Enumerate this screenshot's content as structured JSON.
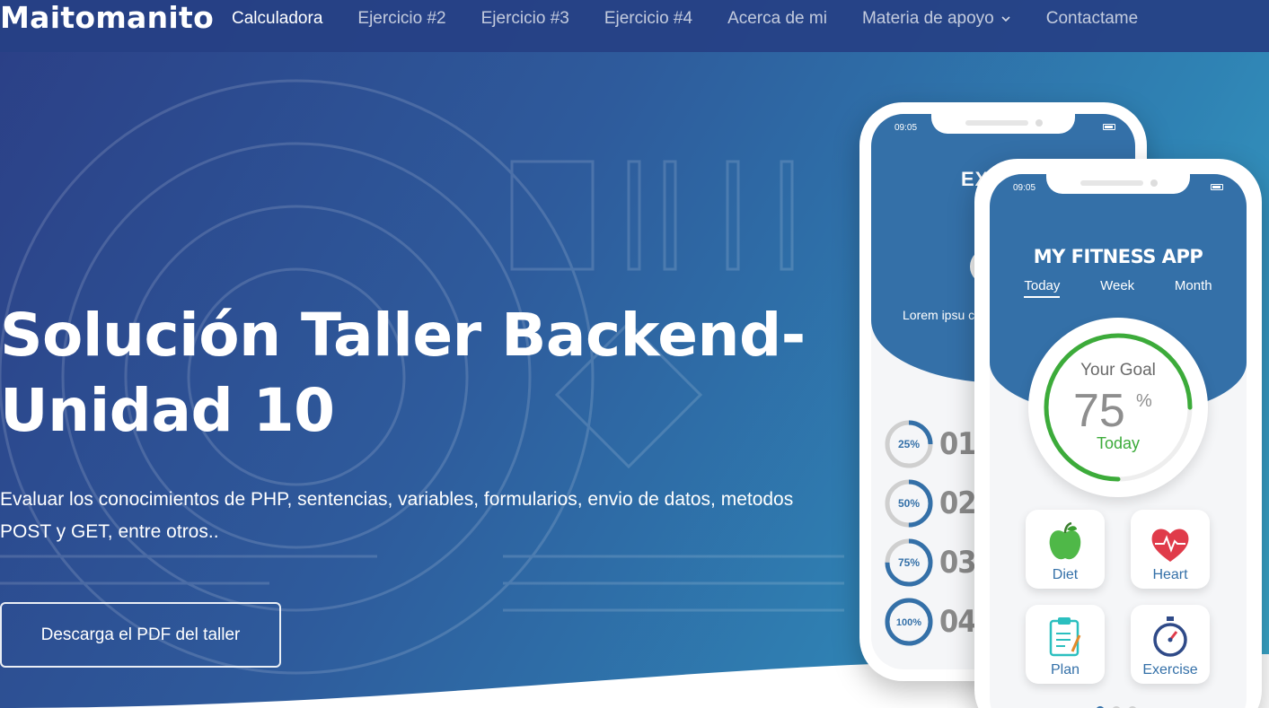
{
  "brand": {
    "name": "Maitomanito"
  },
  "nav": {
    "items": [
      {
        "label": "Calculadora",
        "active": true
      },
      {
        "label": "Ejercicio #2"
      },
      {
        "label": "Ejercicio #3"
      },
      {
        "label": "Ejercicio #4"
      },
      {
        "label": "Acerca de mi"
      },
      {
        "label": "Materia de apoyo"
      },
      {
        "label": "Contactame"
      }
    ]
  },
  "hero": {
    "title": "Solución Taller Backend-Unidad 10",
    "subtitle": "Evaluar los conocimientos de PHP, sentencias, variables, formularios, envio de datos, metodos POST y GET, entre otros..",
    "cta_label": "Descarga el PDF del taller"
  },
  "colors": {
    "primary": "#3470a8",
    "accent_green": "#3cab3a",
    "gradient_start": "#2b3f86",
    "gradient_end": "#3aa7c8"
  },
  "phone_back": {
    "time": "09:05",
    "title": "EXE",
    "lorem": "Lorem ipsu consectetu",
    "progress": [
      {
        "pct": "25%",
        "num": "01",
        "value": 0.25
      },
      {
        "pct": "50%",
        "num": "02",
        "value": 0.5
      },
      {
        "pct": "75%",
        "num": "03",
        "value": 0.75
      },
      {
        "pct": "100%",
        "num": "04",
        "value": 1.0
      }
    ]
  },
  "phone_front": {
    "time": "09:05",
    "app_title": "MY FITNESS APP",
    "tabs": [
      "Today",
      "Week",
      "Month"
    ],
    "goal": {
      "label": "Your Goal",
      "value": "75",
      "unit": "%",
      "sub": "Today",
      "fraction": 0.75
    },
    "tiles": [
      {
        "label": "Diet",
        "icon": "apple-icon"
      },
      {
        "label": "Heart",
        "icon": "heart-icon"
      },
      {
        "label": "Plan",
        "icon": "clipboard-icon"
      },
      {
        "label": "Exercise",
        "icon": "stopwatch-icon"
      }
    ]
  }
}
